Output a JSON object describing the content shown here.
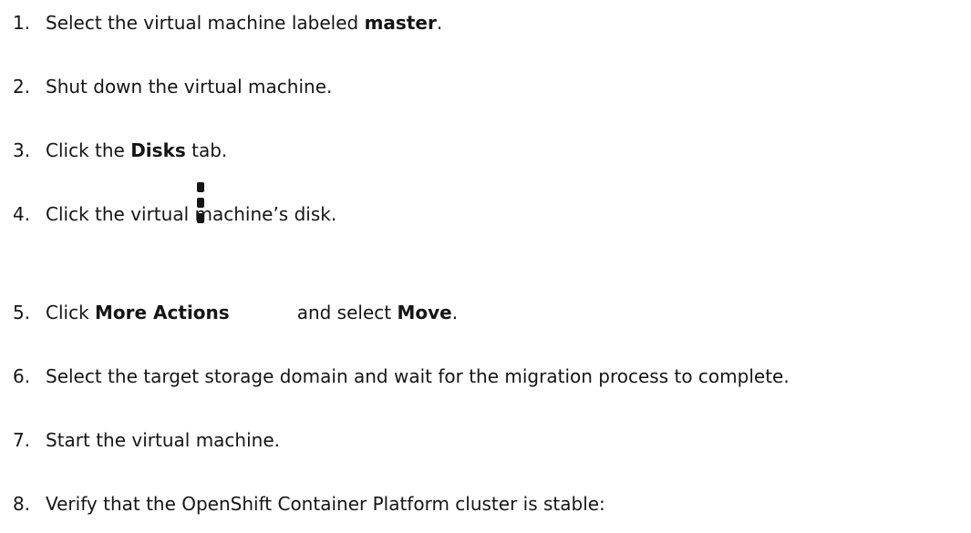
{
  "steps": [
    {
      "num": "1.",
      "before": "Select the virtual machine labeled ",
      "bold": "master",
      "after": "."
    },
    {
      "num": "2.",
      "text": "Shut down the virtual machine."
    },
    {
      "num": "3.",
      "before": "Click the ",
      "bold": "Disks",
      "after": " tab."
    },
    {
      "num": "4.",
      "text": "Click the virtual machine’s disk."
    },
    {
      "num": "5.",
      "before": "Click ",
      "bold": "More Actions",
      "middle": "and select ",
      "bold2": "Move",
      "after": "."
    },
    {
      "num": "6.",
      "text": "Select the target storage domain and wait for the migration process to complete."
    },
    {
      "num": "7.",
      "text": "Start the virtual machine."
    },
    {
      "num": "8.",
      "text": "Verify that the OpenShift Container Platform cluster is stable:"
    }
  ],
  "icons": {
    "more_actions": "kebab-icon"
  }
}
